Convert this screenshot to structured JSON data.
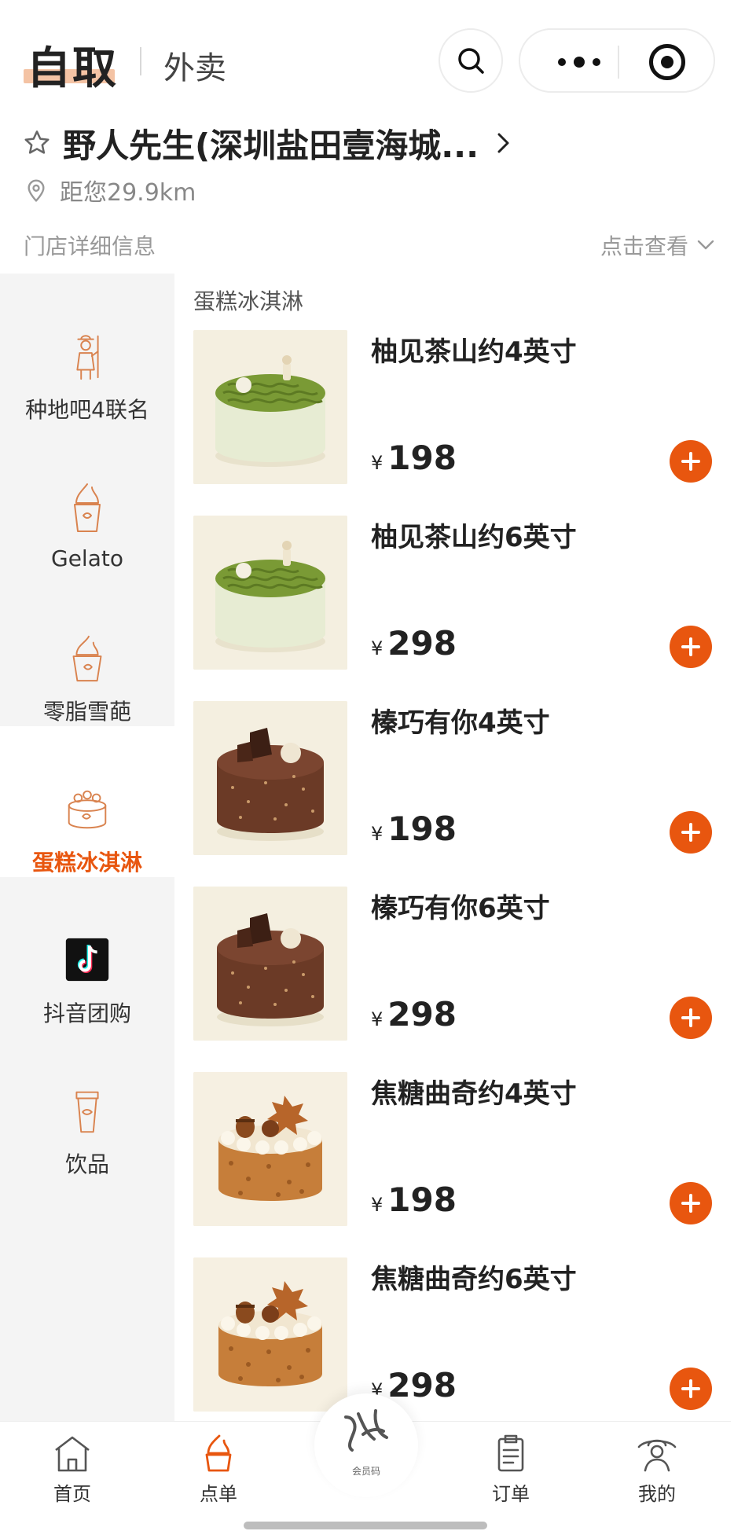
{
  "header": {
    "tab_pickup": "自取",
    "tab_delivery": "外卖"
  },
  "store": {
    "name": "野人先生(深圳盐田壹海城...",
    "distance": "距您29.9km",
    "detail_label": "门店详细信息",
    "detail_link": "点击查看"
  },
  "sidebar": {
    "items": [
      {
        "label": "种地吧4联名",
        "icon": "farmer-icon"
      },
      {
        "label": "Gelato",
        "icon": "gelato-cone-icon"
      },
      {
        "label": "零脂雪葩",
        "icon": "sorbet-cup-icon"
      },
      {
        "label": "蛋糕冰淇淋",
        "icon": "cake-icon"
      },
      {
        "label": "抖音团购",
        "icon": "douyin-logo-icon"
      },
      {
        "label": "饮品",
        "icon": "drink-cup-icon"
      }
    ],
    "active_index": 3
  },
  "section": {
    "title": "蛋糕冰淇淋"
  },
  "products": [
    {
      "name": "柚见茶山约4英寸",
      "price_symbol": "¥",
      "price": "198",
      "image": "matcha-cake"
    },
    {
      "name": "柚见茶山约6英寸",
      "price_symbol": "¥",
      "price": "298",
      "image": "matcha-cake"
    },
    {
      "name": "榛巧有你4英寸",
      "price_symbol": "¥",
      "price": "198",
      "image": "chocolate-cake"
    },
    {
      "name": "榛巧有你6英寸",
      "price_symbol": "¥",
      "price": "298",
      "image": "chocolate-cake"
    },
    {
      "name": "焦糖曲奇约4英寸",
      "price_symbol": "¥",
      "price": "198",
      "image": "caramel-cake"
    },
    {
      "name": "焦糖曲奇约6英寸",
      "price_symbol": "¥",
      "price": "298",
      "image": "caramel-cake"
    }
  ],
  "bottom_nav": {
    "items": [
      {
        "label": "首页",
        "icon": "home-icon"
      },
      {
        "label": "点单",
        "icon": "order-cone-icon"
      },
      {
        "label": "订单",
        "icon": "receipt-icon"
      },
      {
        "label": "我的",
        "icon": "profile-icon"
      }
    ],
    "center_label": "会员码",
    "active_index": 1
  },
  "colors": {
    "accent": "#e8560f",
    "sidebar_bg": "#f4f4f4",
    "text": "#222222",
    "muted": "#999999"
  }
}
